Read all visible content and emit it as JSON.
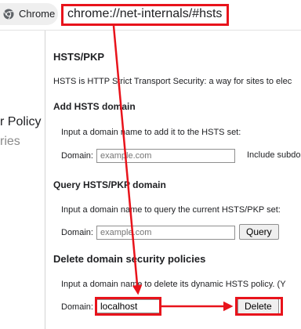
{
  "browser": {
    "chip_label": "Chrome",
    "url": "chrome://net-internals/#hsts"
  },
  "sidebar": {
    "item_policy": "r Policy",
    "item_categories": "ries"
  },
  "page": {
    "title": "HSTS/PKP",
    "description": "HSTS is HTTP Strict Transport Security: a way for sites to elec",
    "add": {
      "heading": "Add HSTS domain",
      "instructions": "Input a domain name to add it to the HSTS set:",
      "domain_label": "Domain:",
      "placeholder": "example.com",
      "include_subdomains": "Include subdo"
    },
    "query": {
      "heading": "Query HSTS/PKP domain",
      "instructions": "Input a domain name to query the current HSTS/PKP set:",
      "domain_label": "Domain:",
      "placeholder": "example.com",
      "button": "Query"
    },
    "delete": {
      "heading": "Delete domain security policies",
      "instructions": "Input a domain name to delete its dynamic HSTS policy. (Y",
      "domain_label": "Domain:",
      "value": "localhost",
      "button": "Delete"
    }
  },
  "annotation": {
    "color": "#e8131b"
  }
}
